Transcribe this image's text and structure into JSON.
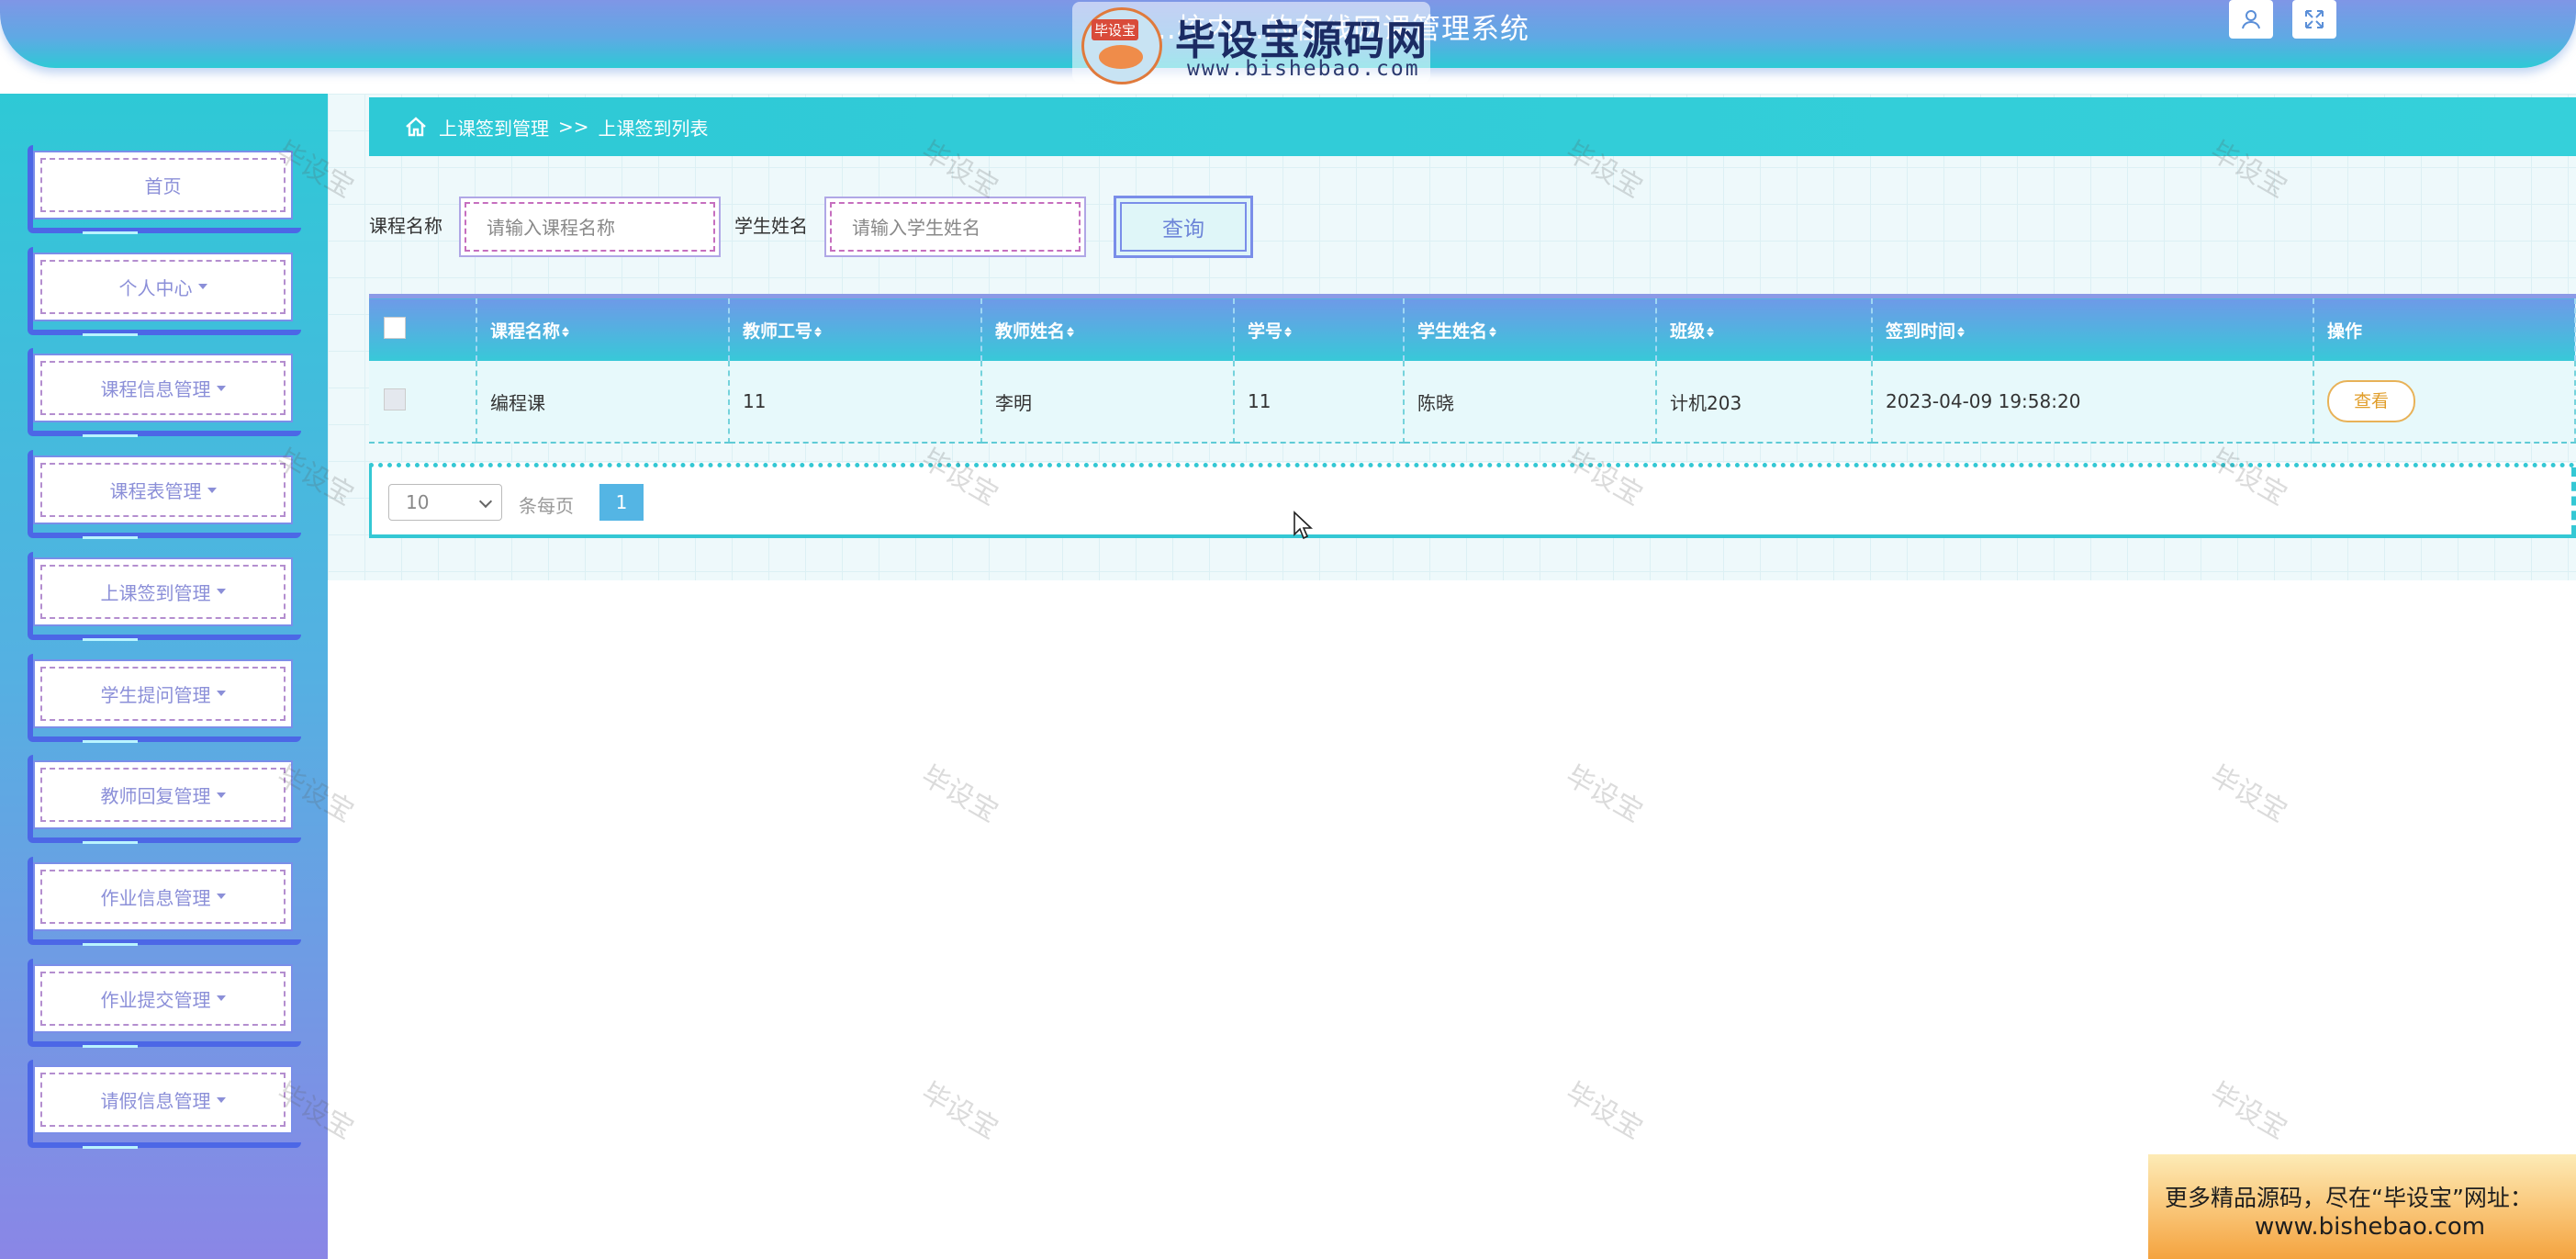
{
  "header": {
    "title": "…校内…的在线网课管理系统",
    "user_icon": "user-icon",
    "fullscreen_icon": "fullscreen-icon"
  },
  "logo_watermark": {
    "badge_text": "毕设宝",
    "brand": "毕设宝源码网",
    "url": "www.bishebao.com"
  },
  "sidebar": {
    "items": [
      {
        "label": "首页",
        "has_caret": false
      },
      {
        "label": "个人中心",
        "has_caret": true
      },
      {
        "label": "课程信息管理",
        "has_caret": true
      },
      {
        "label": "课程表管理",
        "has_caret": true
      },
      {
        "label": "上课签到管理",
        "has_caret": true
      },
      {
        "label": "学生提问管理",
        "has_caret": true
      },
      {
        "label": "教师回复管理",
        "has_caret": true
      },
      {
        "label": "作业信息管理",
        "has_caret": true
      },
      {
        "label": "作业提交管理",
        "has_caret": true
      },
      {
        "label": "请假信息管理",
        "has_caret": true
      }
    ]
  },
  "breadcrumb": {
    "parent": "上课签到管理",
    "separator": ">>",
    "current": "上课签到列表",
    "icon": "home-icon"
  },
  "filters": {
    "course_label": "课程名称",
    "course_placeholder": "请输入课程名称",
    "course_value": "",
    "student_label": "学生姓名",
    "student_placeholder": "请输入学生姓名",
    "student_value": "",
    "query_button": "查询"
  },
  "table": {
    "columns": [
      "课程名称",
      "教师工号",
      "教师姓名",
      "学号",
      "学生姓名",
      "班级",
      "签到时间",
      "操作"
    ],
    "rows": [
      {
        "course": "编程课",
        "teacher_id": "11",
        "teacher_name": "李明",
        "student_id": "11",
        "student_name": "陈晓",
        "class": "计机203",
        "checkin_time": "2023-04-09 19:58:20",
        "action": "查看"
      }
    ]
  },
  "pager": {
    "page_size": "10",
    "page_size_label": "条每页",
    "current_page": "1"
  },
  "watermark_text": "毕设宝",
  "promo": {
    "line1": "更多精品源码，尽在“毕设宝”网址：",
    "line2": "www.bishebao.com"
  },
  "colors": {
    "accent_cyan": "#2ec9d6",
    "accent_blue": "#4c67e6",
    "view_button": "#e19e2b"
  }
}
